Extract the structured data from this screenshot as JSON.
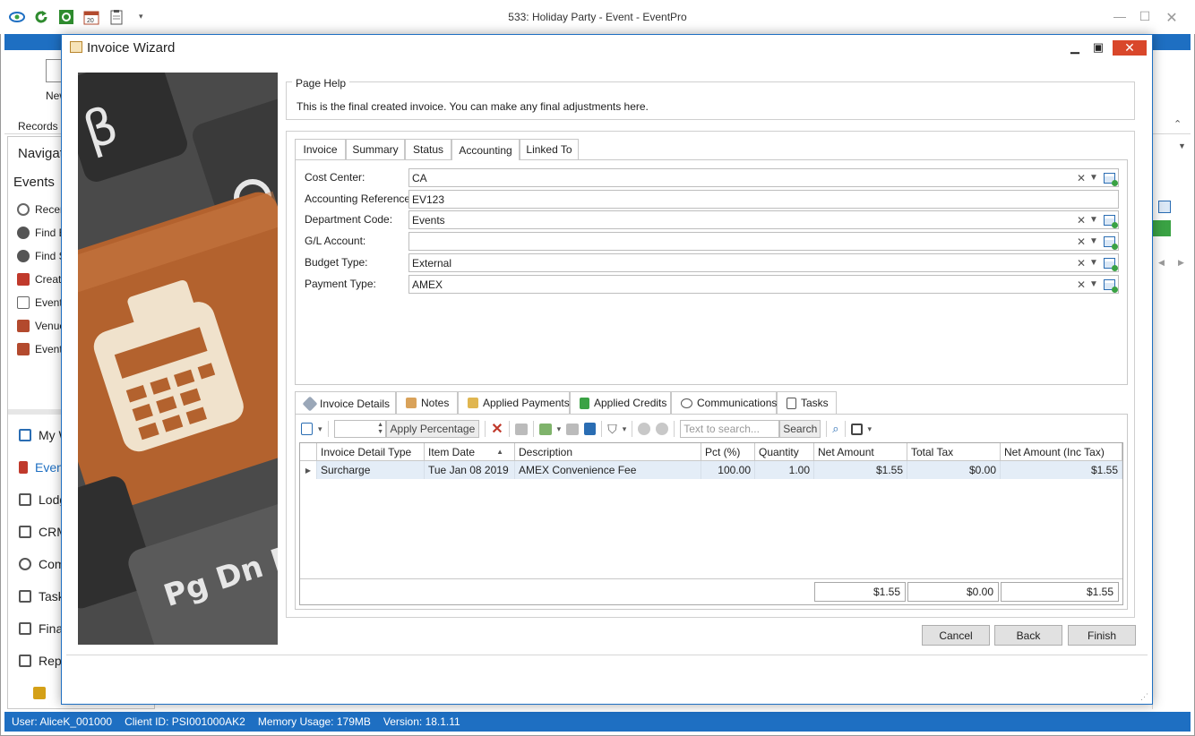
{
  "app": {
    "title": "533: Holiday Party - Event - EventPro",
    "ribbon": {
      "new_label": "New",
      "records_label": "Records O"
    },
    "navigation": {
      "header": "Navigati",
      "section": "Events",
      "items": [
        "Recen",
        "Find E",
        "Find S",
        "Create",
        "Event",
        "Venue",
        "Event"
      ],
      "modules": [
        "My W",
        "Even",
        "Lodg",
        "CRM",
        "Com",
        "Task",
        "Fina",
        "Repo"
      ]
    },
    "status_bar": {
      "user": "User: AliceK_001000",
      "client": "Client ID: PSI001000AK2",
      "memory": "Memory Usage: 179MB",
      "version": "Version: 18.1.11"
    }
  },
  "dialog": {
    "title": "Invoice Wizard",
    "page_help": {
      "legend": "Page Help",
      "text": "This is the final created invoice.  You can make any final adjustments here."
    },
    "tabs": [
      "Invoice",
      "Summary",
      "Status",
      "Accounting",
      "Linked To"
    ],
    "active_tab": "Accounting",
    "fields": [
      {
        "label": "Cost Center:",
        "value": "CA"
      },
      {
        "label": "Accounting Reference:",
        "value": "EV123"
      },
      {
        "label": "Department Code:",
        "value": "Events"
      },
      {
        "label": "G/L Account:",
        "value": ""
      },
      {
        "label": "Budget Type:",
        "value": "External"
      },
      {
        "label": "Payment Type:",
        "value": "AMEX"
      }
    ],
    "bottom_tabs": [
      "Invoice Details",
      "Notes",
      "Applied Payments",
      "Applied Credits",
      "Communications",
      "Tasks"
    ],
    "toolbar": {
      "apply_percentage": "Apply Percentage",
      "search_placeholder": "Text to search...",
      "search_button": "Search"
    },
    "grid": {
      "columns": [
        "Invoice Detail Type",
        "Item Date",
        "Description",
        "Pct (%)",
        "Quantity",
        "Net Amount",
        "Total Tax",
        "Net Amount (Inc Tax)"
      ],
      "rows": [
        [
          "Surcharge",
          "Tue Jan 08 2019",
          "AMEX Convenience Fee",
          "100.00",
          "1.00",
          "$1.55",
          "$0.00",
          "$1.55"
        ]
      ],
      "totals": {
        "net_amount": "$1.55",
        "total_tax": "$0.00",
        "net_inc_tax": "$1.55"
      }
    },
    "buttons": {
      "cancel": "Cancel",
      "back": "Back",
      "finish": "Finish"
    },
    "photo_keys": {
      "beta": "β",
      "pgdn": "Pg Dn E"
    }
  },
  "colors": {
    "accent": "#1e6fc2",
    "close": "#d9472b",
    "selected_row": "#e4edf7",
    "key_orange": "#b3622e"
  }
}
